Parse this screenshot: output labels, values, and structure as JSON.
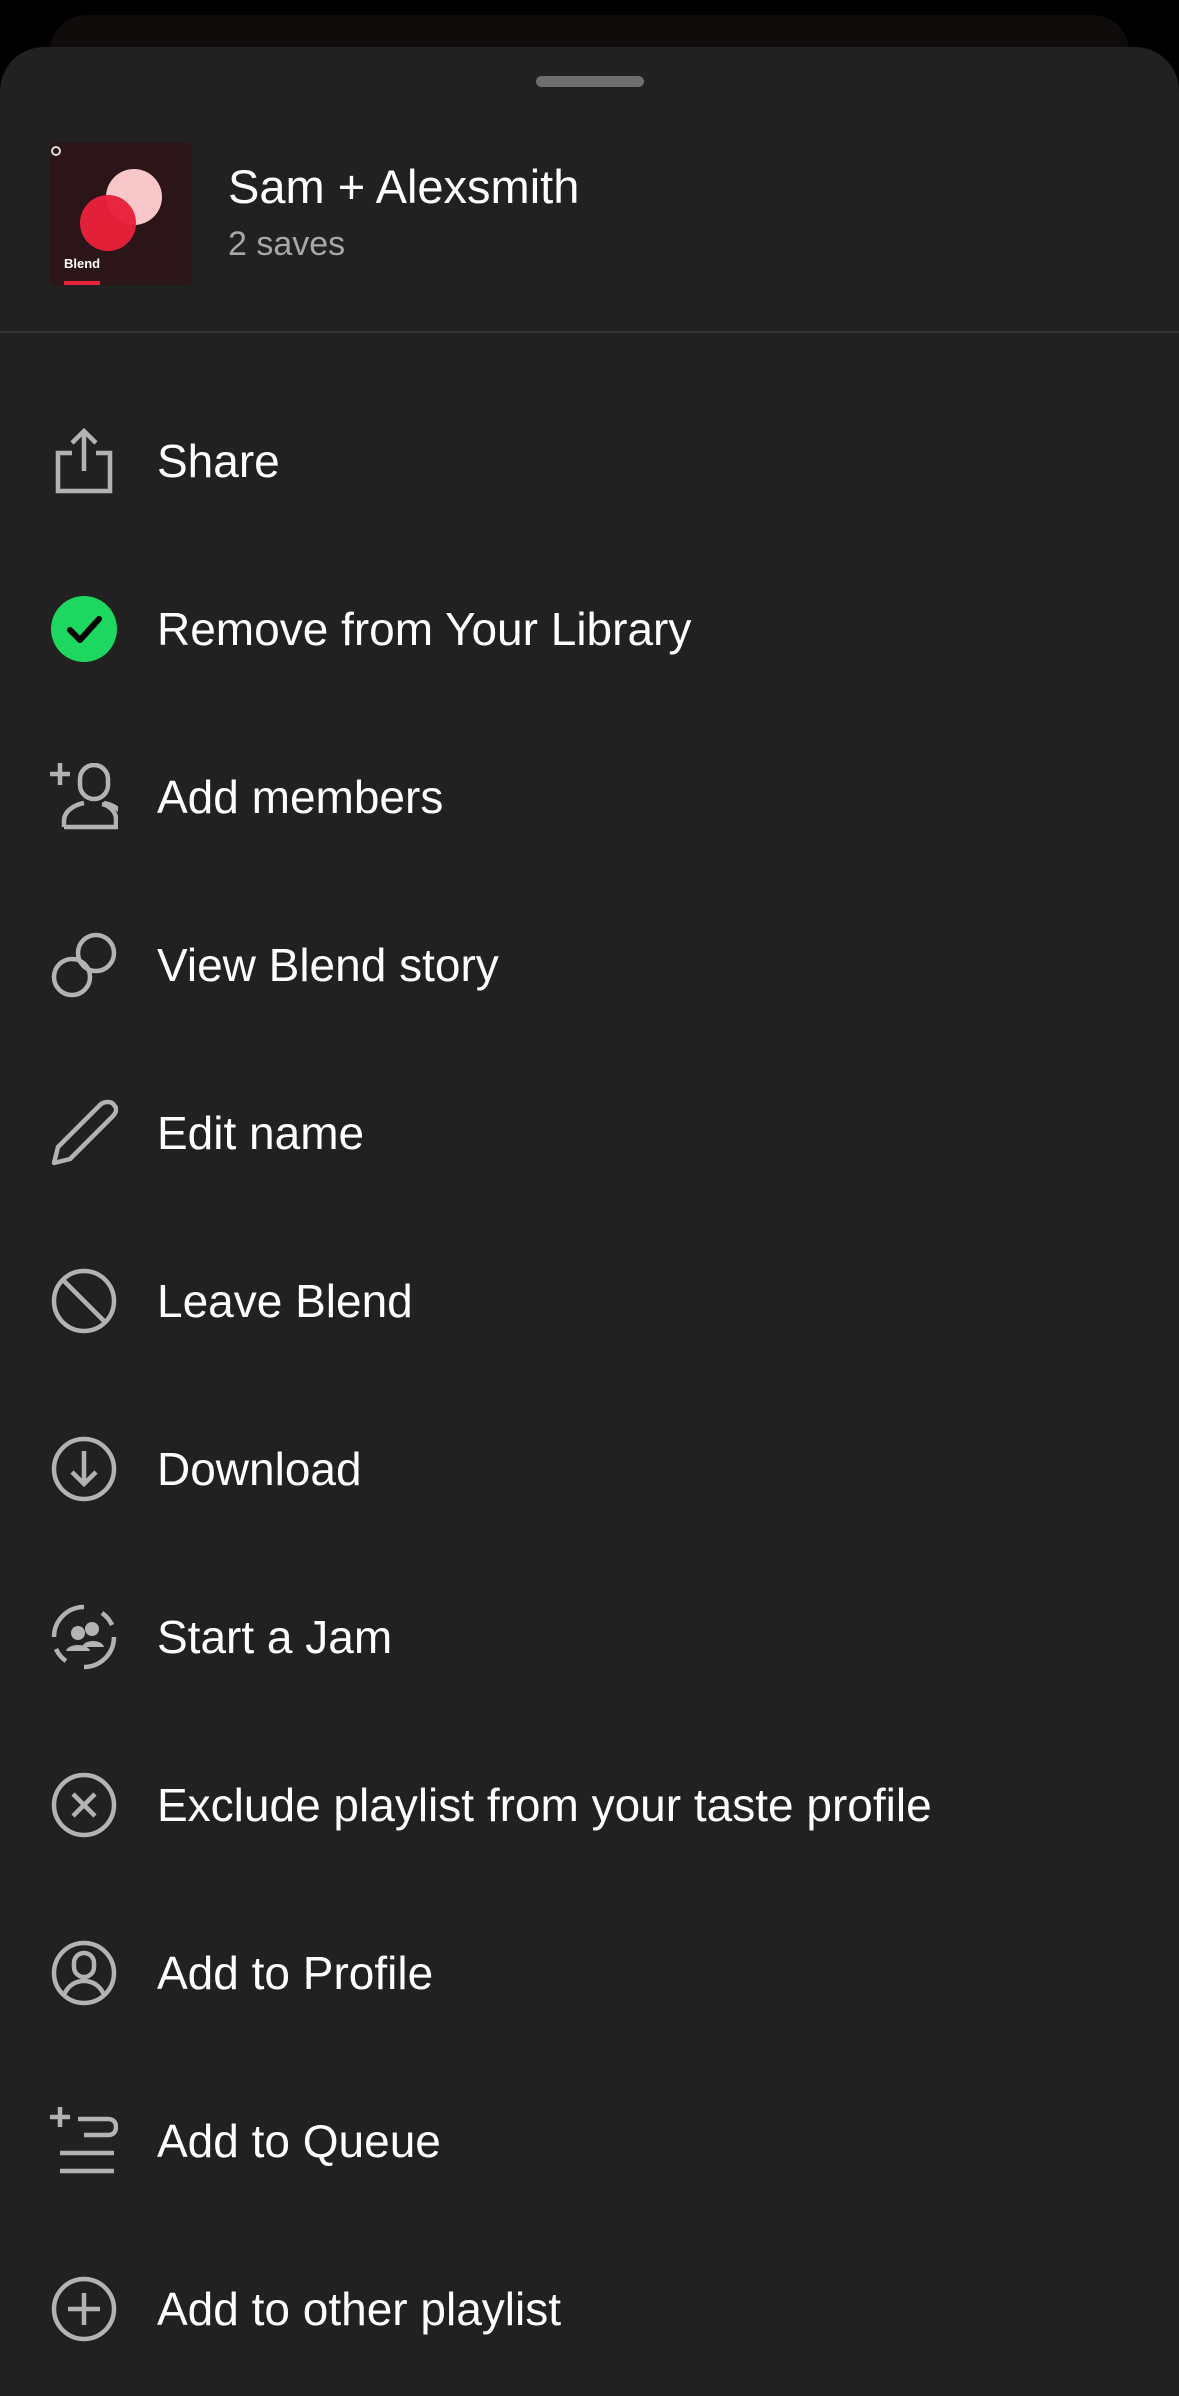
{
  "header": {
    "title": "Sam + Alexsmith",
    "subtitle": "2 saves",
    "cover_label": "Blend"
  },
  "menu": {
    "items": [
      {
        "label": "Share",
        "icon": "share-icon"
      },
      {
        "label": "Remove from Your Library",
        "icon": "check-circle-icon"
      },
      {
        "label": "Add members",
        "icon": "add-person-icon"
      },
      {
        "label": "View Blend story",
        "icon": "blend-circles-icon"
      },
      {
        "label": "Edit name",
        "icon": "pencil-icon"
      },
      {
        "label": "Leave Blend",
        "icon": "block-icon"
      },
      {
        "label": "Download",
        "icon": "download-icon"
      },
      {
        "label": "Start a Jam",
        "icon": "jam-icon"
      },
      {
        "label": "Exclude playlist from your taste profile",
        "icon": "close-circle-icon"
      },
      {
        "label": "Add to Profile",
        "icon": "profile-icon"
      },
      {
        "label": "Add to Queue",
        "icon": "queue-icon"
      },
      {
        "label": "Add to other playlist",
        "icon": "plus-circle-icon"
      }
    ]
  },
  "colors": {
    "sheet_background": "#212121",
    "accent_green": "#1ed760",
    "icon_gray": "#b3b3b3",
    "text_primary": "#ffffff",
    "text_secondary": "#a7a7a7",
    "cover_red": "#e8213a"
  }
}
